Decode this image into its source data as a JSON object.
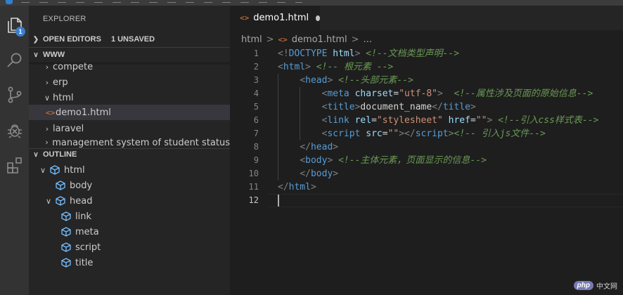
{
  "activity": {
    "explorer_badge": "1",
    "icons": [
      "files-icon",
      "search-icon",
      "source-control-icon",
      "debug-icon",
      "extensions-icon"
    ]
  },
  "sidebar": {
    "title": "EXPLORER",
    "open_editors": {
      "label": "OPEN EDITORS",
      "unsaved": "1 UNSAVED"
    },
    "folder": {
      "label": "WWW",
      "items": [
        {
          "label": "compete",
          "type": "folder"
        },
        {
          "label": "erp",
          "type": "folder"
        },
        {
          "label": "html",
          "type": "folder"
        },
        {
          "label": "demo1.html",
          "type": "file",
          "icon": "<>"
        },
        {
          "label": "laravel",
          "type": "folder"
        },
        {
          "label": "management system of student status",
          "type": "folder"
        }
      ]
    },
    "outline": {
      "label": "OUTLINE",
      "items": [
        {
          "label": "html",
          "expanded": true
        },
        {
          "label": "body"
        },
        {
          "label": "head",
          "expanded": true
        },
        {
          "label": "link"
        },
        {
          "label": "meta"
        },
        {
          "label": "script"
        },
        {
          "label": "title"
        }
      ]
    }
  },
  "editor": {
    "tab": {
      "icon": "<>",
      "label": "demo1.html"
    },
    "breadcrumb": {
      "folder": "html",
      "separator": ">",
      "icon": "<>",
      "file": "demo1.html",
      "more": "..."
    },
    "line_numbers": [
      "1",
      "2",
      "3",
      "4",
      "5",
      "6",
      "7",
      "8",
      "9",
      "10",
      "11",
      "12"
    ],
    "lines": [
      {
        "indent": "",
        "tokens": [
          [
            "br",
            "<!"
          ],
          [
            "tag",
            "DOCTYPE"
          ],
          [
            "txt",
            " "
          ],
          [
            "attr",
            "html"
          ],
          [
            "br",
            ">"
          ],
          [
            "txt",
            " "
          ],
          [
            "com",
            "<!--文档类型声明-->"
          ]
        ]
      },
      {
        "indent": "",
        "tokens": [
          [
            "br",
            "<"
          ],
          [
            "tag",
            "html"
          ],
          [
            "br",
            ">"
          ],
          [
            "txt",
            " "
          ],
          [
            "com",
            "<!-- 根元素 -->"
          ]
        ]
      },
      {
        "indent": "    ",
        "tokens": [
          [
            "br",
            "<"
          ],
          [
            "tag",
            "head"
          ],
          [
            "br",
            ">"
          ],
          [
            "txt",
            " "
          ],
          [
            "com",
            "<!--头部元素-->"
          ]
        ]
      },
      {
        "indent": "        ",
        "tokens": [
          [
            "br",
            "<"
          ],
          [
            "tag",
            "meta"
          ],
          [
            "txt",
            " "
          ],
          [
            "attr",
            "charset"
          ],
          [
            "txt",
            "="
          ],
          [
            "str",
            "\"utf-8\""
          ],
          [
            "br",
            ">"
          ],
          [
            "txt",
            "  "
          ],
          [
            "com",
            "<!--属性涉及页面的原始信息-->"
          ]
        ]
      },
      {
        "indent": "        ",
        "tokens": [
          [
            "br",
            "<"
          ],
          [
            "tag",
            "title"
          ],
          [
            "br",
            ">"
          ],
          [
            "txt",
            "document_name"
          ],
          [
            "br",
            "</"
          ],
          [
            "tag",
            "title"
          ],
          [
            "br",
            ">"
          ]
        ]
      },
      {
        "indent": "        ",
        "tokens": [
          [
            "br",
            "<"
          ],
          [
            "tag",
            "link"
          ],
          [
            "txt",
            " "
          ],
          [
            "attr",
            "rel"
          ],
          [
            "txt",
            "="
          ],
          [
            "str",
            "\"stylesheet\""
          ],
          [
            "txt",
            " "
          ],
          [
            "attr",
            "href"
          ],
          [
            "txt",
            "="
          ],
          [
            "str",
            "\"\""
          ],
          [
            "br",
            ">"
          ],
          [
            "txt",
            " "
          ],
          [
            "com",
            "<!--引入css样式表-->"
          ]
        ]
      },
      {
        "indent": "        ",
        "tokens": [
          [
            "br",
            "<"
          ],
          [
            "tag",
            "script"
          ],
          [
            "txt",
            " "
          ],
          [
            "attr",
            "src"
          ],
          [
            "txt",
            "="
          ],
          [
            "str",
            "\"\""
          ],
          [
            "br",
            "></"
          ],
          [
            "tag",
            "script"
          ],
          [
            "br",
            ">"
          ],
          [
            "com",
            "<!-- 引入js文件-->"
          ]
        ]
      },
      {
        "indent": "    ",
        "tokens": [
          [
            "br",
            "</"
          ],
          [
            "tag",
            "head"
          ],
          [
            "br",
            ">"
          ]
        ]
      },
      {
        "indent": "    ",
        "tokens": [
          [
            "br",
            "<"
          ],
          [
            "tag",
            "body"
          ],
          [
            "br",
            ">"
          ],
          [
            "txt",
            " "
          ],
          [
            "com",
            "<!--主体元素，页面显示的信息-->"
          ]
        ]
      },
      {
        "indent": "    ",
        "tokens": [
          [
            "br",
            "</"
          ],
          [
            "tag",
            "body"
          ],
          [
            "br",
            ">"
          ]
        ]
      },
      {
        "indent": "",
        "tokens": [
          [
            "br",
            "</"
          ],
          [
            "tag",
            "html"
          ],
          [
            "br",
            ">"
          ]
        ]
      },
      {
        "indent": "",
        "tokens": []
      }
    ]
  },
  "watermark": {
    "logo": "php",
    "text": "中文网"
  },
  "colors": {
    "activity_bg": "#333333",
    "sidebar_bg": "#252526",
    "editor_bg": "#1e1e1e",
    "tag": "#569cd6",
    "attribute": "#9cdcfe",
    "string": "#ce9178",
    "comment": "#6a9955",
    "file_icon": "#e37933",
    "outline_icon": "#75beff",
    "badge": "#3b7fce"
  }
}
